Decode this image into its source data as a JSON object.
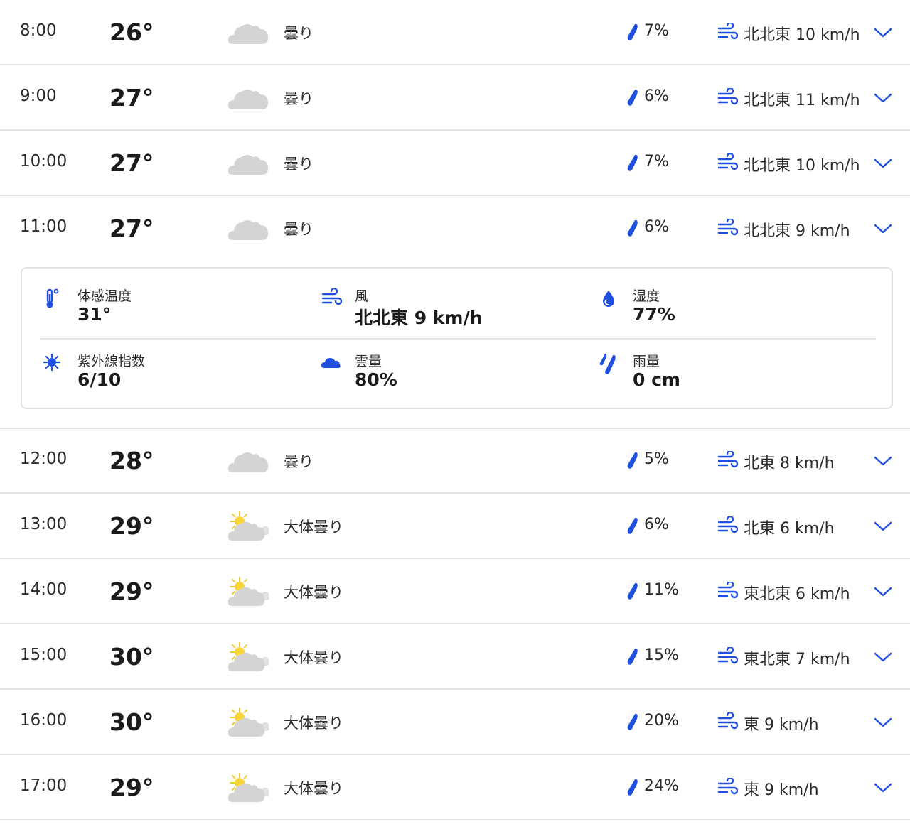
{
  "colors": {
    "accent": "#1f4fe0",
    "divider": "#e3e3e3",
    "cloud": "#d3d3d3",
    "sun": "#f5d236"
  },
  "hours": [
    {
      "time": "8:00",
      "temp": "26°",
      "icon": "cloudy-icon",
      "condition": "曇り",
      "rain": "7%",
      "wind": "北北東 10 km/h"
    },
    {
      "time": "9:00",
      "temp": "27°",
      "icon": "cloudy-icon",
      "condition": "曇り",
      "rain": "6%",
      "wind": "北北東 11 km/h"
    },
    {
      "time": "10:00",
      "temp": "27°",
      "icon": "cloudy-icon",
      "condition": "曇り",
      "rain": "7%",
      "wind": "北北東 10 km/h"
    },
    {
      "time": "11:00",
      "temp": "27°",
      "icon": "cloudy-icon",
      "condition": "曇り",
      "rain": "6%",
      "wind": "北北東 9 km/h"
    },
    {
      "time": "12:00",
      "temp": "28°",
      "icon": "cloudy-icon",
      "condition": "曇り",
      "rain": "5%",
      "wind": "北東 8 km/h"
    },
    {
      "time": "13:00",
      "temp": "29°",
      "icon": "mostly-cloudy-icon",
      "condition": "大体曇り",
      "rain": "6%",
      "wind": "北東 6 km/h"
    },
    {
      "time": "14:00",
      "temp": "29°",
      "icon": "mostly-cloudy-icon",
      "condition": "大体曇り",
      "rain": "11%",
      "wind": "東北東 6 km/h"
    },
    {
      "time": "15:00",
      "temp": "30°",
      "icon": "mostly-cloudy-icon",
      "condition": "大体曇り",
      "rain": "15%",
      "wind": "東北東 7 km/h"
    },
    {
      "time": "16:00",
      "temp": "30°",
      "icon": "mostly-cloudy-icon",
      "condition": "大体曇り",
      "rain": "20%",
      "wind": "東 9 km/h"
    },
    {
      "time": "17:00",
      "temp": "29°",
      "icon": "mostly-cloudy-icon",
      "condition": "大体曇り",
      "rain": "24%",
      "wind": "東 9 km/h"
    }
  ],
  "details": {
    "feels_like": {
      "label": "体感温度",
      "value": "31°",
      "icon": "thermometer-icon"
    },
    "wind": {
      "label": "風",
      "value": "北北東 9 km/h",
      "icon": "wind-icon"
    },
    "humidity": {
      "label": "湿度",
      "value": "77%",
      "icon": "humidity-drop-icon"
    },
    "uv_index": {
      "label": "紫外線指数",
      "value": "6/10",
      "icon": "sun-icon"
    },
    "cloud_cover": {
      "label": "雲量",
      "value": "80%",
      "icon": "cloud-icon"
    },
    "rainfall": {
      "label": "雨量",
      "value": "0 cm",
      "icon": "rain-icon"
    }
  }
}
